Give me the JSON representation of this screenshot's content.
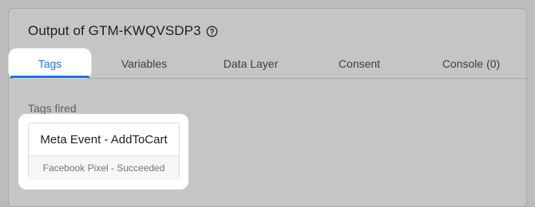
{
  "header": {
    "title": "Output of GTM-KWQVSDP3",
    "help_icon": "help-circle-icon"
  },
  "tabs": [
    {
      "label": "Tags",
      "active": true
    },
    {
      "label": "Variables",
      "active": false
    },
    {
      "label": "Data Layer",
      "active": false
    },
    {
      "label": "Consent",
      "active": false
    },
    {
      "label": "Console (0)",
      "active": false
    }
  ],
  "section": {
    "label": "Tags fired"
  },
  "tags_fired": [
    {
      "name": "Meta Event - AddToCart",
      "status": "Facebook Pixel - Succeeded"
    }
  ],
  "colors": {
    "accent": "#1a73e8",
    "overlay": "#c5c5c5"
  }
}
